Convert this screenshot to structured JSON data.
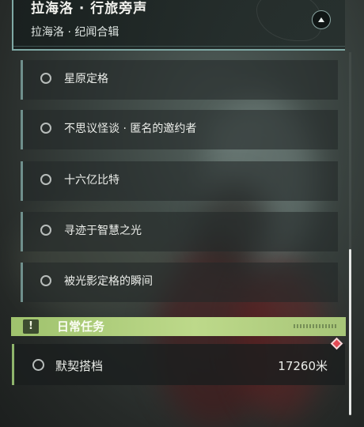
{
  "header": {
    "title": "拉海洛 · 行旅旁声",
    "subtitle": "拉海洛 · 纪闻合辑"
  },
  "quests": [
    {
      "label": "星原定格"
    },
    {
      "label": "不思议怪谈 · 匿名的邀约者"
    },
    {
      "label": "十六亿比特"
    },
    {
      "label": "寻迹于智慧之光"
    },
    {
      "label": "被光影定格的瞬间"
    }
  ],
  "daily_section": {
    "icon": "!",
    "title": "日常任务",
    "items": [
      {
        "label": "默契搭档",
        "distance": "17260米"
      }
    ]
  },
  "colors": {
    "accent_teal": "#7fa9a5",
    "daily_green": "#9fc26d",
    "marker_red": "#e44a55"
  },
  "icons": [
    "collapse-arrow-icon",
    "quest-circle-icon",
    "warning-icon",
    "map-marker-icon"
  ]
}
